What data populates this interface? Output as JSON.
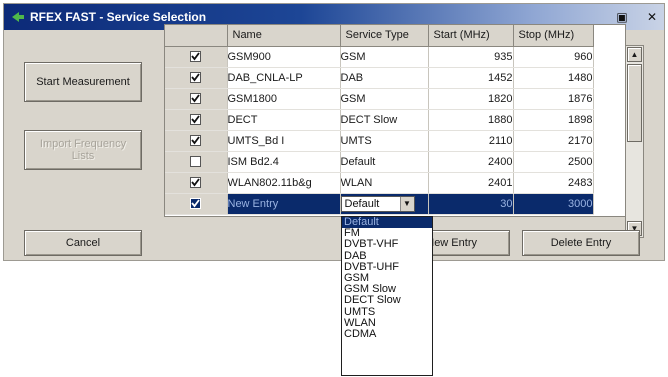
{
  "window": {
    "title": "RFEX FAST - Service Selection",
    "buttons": {
      "minimize_glyph": "▣",
      "close_glyph": "✕"
    }
  },
  "left_panel": {
    "start_measurement": "Start Measurement",
    "import_frequency_lists": "Import Frequency Lists",
    "cancel": "Cancel"
  },
  "grid": {
    "columns": [
      "Name",
      "Service Type",
      "Start (MHz)",
      "Stop (MHz)"
    ],
    "rows": [
      {
        "checked": true,
        "name": "GSM900",
        "service": "GSM",
        "start": "935",
        "stop": "960"
      },
      {
        "checked": true,
        "name": "DAB_CNLA-LP",
        "service": "DAB",
        "start": "1452",
        "stop": "1480"
      },
      {
        "checked": true,
        "name": "GSM1800",
        "service": "GSM",
        "start": "1820",
        "stop": "1876"
      },
      {
        "checked": true,
        "name": "DECT",
        "service": "DECT Slow",
        "start": "1880",
        "stop": "1898"
      },
      {
        "checked": true,
        "name": "UMTS_Bd I",
        "service": "UMTS",
        "start": "2110",
        "stop": "2170"
      },
      {
        "checked": false,
        "name": "ISM Bd2.4",
        "service": "Default",
        "start": "2400",
        "stop": "2500"
      },
      {
        "checked": true,
        "name": "WLAN802.11b&g",
        "service": "WLAN",
        "start": "2401",
        "stop": "2483"
      },
      {
        "checked": true,
        "name": "New Entry",
        "service": "Default",
        "start": "30",
        "stop": "3000",
        "selected": true
      }
    ]
  },
  "bottom": {
    "new_entry": "New Entry",
    "delete_entry": "Delete Entry"
  },
  "service_dropdown": {
    "selected": "Default",
    "options": [
      "Default",
      "FM",
      "DVBT-VHF",
      "DAB",
      "DVBT-UHF",
      "GSM",
      "GSM Slow",
      "DECT Slow",
      "UMTS",
      "WLAN",
      "CDMA"
    ]
  }
}
